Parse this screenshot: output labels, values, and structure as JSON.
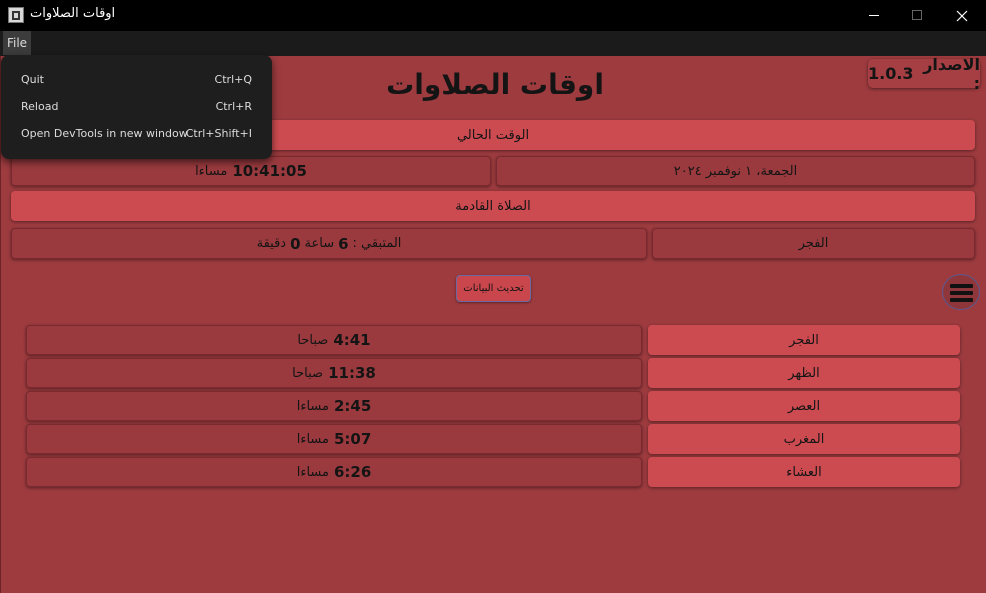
{
  "window": {
    "title": "اوقات الصلاوات"
  },
  "menubar": {
    "file_label": "File"
  },
  "file_menu": [
    {
      "label": "Quit",
      "shortcut": "Ctrl+Q"
    },
    {
      "label": "Reload",
      "shortcut": "Ctrl+R"
    },
    {
      "label": "Open DevTools in new window",
      "shortcut": "Ctrl+Shift+I"
    }
  ],
  "app": {
    "heading": "اوقات الصلاوات",
    "version_label": "الاصدار :",
    "version_number": "1.0.3",
    "current_time_header": "الوقت الحالي",
    "date": "الجمعة، ١ نوفمبر ٢٠٢٤",
    "time_value": "10:41:05",
    "time_suffix": "مساءا",
    "next_prayer_header": "الصلاة القادمة",
    "next_prayer_name": "الفجر",
    "remaining_label": "المتبقي :",
    "remaining_hours": "6",
    "hours_word": "ساعة",
    "remaining_minutes": "0",
    "minutes_word": "دقيقة",
    "update_button": "تحديث البيانات",
    "prayers": [
      {
        "name": "الفجر",
        "time": "4:41",
        "period": "صباحا"
      },
      {
        "name": "الظهر",
        "time": "11:38",
        "period": "صباحا"
      },
      {
        "name": "العصر",
        "time": "2:45",
        "period": "مساءا"
      },
      {
        "name": "المغرب",
        "time": "5:07",
        "period": "مساءا"
      },
      {
        "name": "العشاء",
        "time": "6:26",
        "period": "مساءا"
      }
    ]
  },
  "icons": {
    "app_icon": "app-icon",
    "menu": "hamburger-menu-icon",
    "minimize": "minimize-icon",
    "maximize": "maximize-icon",
    "close": "close-icon"
  },
  "colors": {
    "background": "#9d3b3f",
    "accent": "#cc4b51",
    "menu_bg": "#1e1e1e"
  }
}
